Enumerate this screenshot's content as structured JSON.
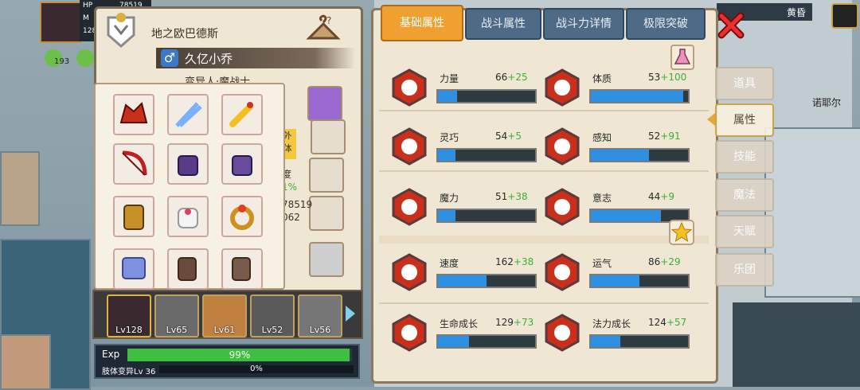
{
  "hud": {
    "line1": "HP",
    "line1_val": "78519",
    "line2": "M",
    "line3": "128",
    "level_small": "193"
  },
  "character": {
    "faction": "地之欧巴德斯",
    "name": "久亿小乔",
    "gender_symbol": "♂",
    "class_name": "变异人·魔战士",
    "side_tag_1": "外",
    "side_tag_2": "体",
    "side_text_1": "度",
    "side_text_2": "1%",
    "side_num_1": "78519",
    "side_num_2": "062"
  },
  "party": [
    {
      "level": "Lv128"
    },
    {
      "level": "Lv65"
    },
    {
      "level": "Lv61"
    },
    {
      "level": "Lv52"
    },
    {
      "level": "Lv56"
    }
  ],
  "exp": {
    "label": "Exp",
    "value": "99%",
    "fill": 0.99,
    "limb_label": "肢体变异Lv 36",
    "limb_value": "0%",
    "limb_fill": 0
  },
  "tabs": [
    "基础属性",
    "战斗属性",
    "战斗力详情",
    "极限突破"
  ],
  "stats": [
    {
      "name": "力量",
      "base": "66",
      "bonus": "+25",
      "fill": 0.2
    },
    {
      "name": "体质",
      "base": "53",
      "bonus": "+100",
      "fill": 0.95
    },
    {
      "name": "灵巧",
      "base": "54",
      "bonus": "+5",
      "fill": 0.18
    },
    {
      "name": "感知",
      "base": "52",
      "bonus": "+91",
      "fill": 0.6
    },
    {
      "name": "魔力",
      "base": "51",
      "bonus": "+38",
      "fill": 0.18
    },
    {
      "name": "意志",
      "base": "44",
      "bonus": "+9",
      "fill": 0.72
    },
    {
      "name": "速度",
      "base": "162",
      "bonus": "+38",
      "fill": 0.5
    },
    {
      "name": "运气",
      "base": "86",
      "bonus": "+29",
      "fill": 0.5
    },
    {
      "name": "生命成长",
      "base": "129",
      "bonus": "+73",
      "fill": 0.32
    },
    {
      "name": "法力成长",
      "base": "124",
      "bonus": "+57",
      "fill": 0.3
    }
  ],
  "side_menu": [
    "道具",
    "属性",
    "技能",
    "魔法",
    "天赋",
    "乐团"
  ],
  "map": {
    "north_label": "诺耶尔",
    "top_label": "黄昏"
  },
  "colors": {
    "bar_fill": "#2f8fe0",
    "bonus": "#3ab03a",
    "active_tab": "#f0a030"
  }
}
